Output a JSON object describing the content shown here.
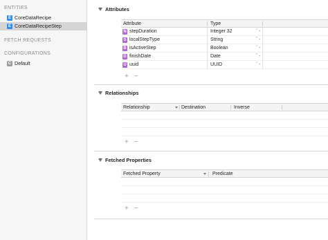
{
  "sidebar": {
    "entities_header": "ENTITIES",
    "entities": [
      {
        "badge": "E",
        "label": "CoreDataRecipe",
        "selected": false
      },
      {
        "badge": "E",
        "label": "CoreDataRecipeStep",
        "selected": true
      }
    ],
    "fetch_requests_header": "FETCH REQUESTS",
    "configurations_header": "CONFIGURATIONS",
    "configurations": [
      {
        "badge": "C",
        "label": "Default"
      }
    ]
  },
  "attributes": {
    "title": "Attributes",
    "col_attribute": "Attribute",
    "col_type": "Type",
    "rows": [
      {
        "badge": "N",
        "name": "stepDuration",
        "type": "Integer 32"
      },
      {
        "badge": "S",
        "name": "localStepType",
        "type": "String"
      },
      {
        "badge": "B",
        "name": "isActiveStep",
        "type": "Boolean"
      },
      {
        "badge": "D",
        "name": "finishDate",
        "type": "Date"
      },
      {
        "badge": "U",
        "name": "uuid",
        "type": "UUID"
      }
    ]
  },
  "relationships": {
    "title": "Relationships",
    "col_relationship": "Relationship",
    "col_destination": "Destination",
    "col_inverse": "Inverse"
  },
  "fetched_properties": {
    "title": "Fetched Properties",
    "col_fetched_property": "Fetched Property",
    "col_predicate": "Predicate"
  },
  "controls": {
    "add": "+",
    "remove": "−",
    "stepper": "⌃⌄"
  }
}
